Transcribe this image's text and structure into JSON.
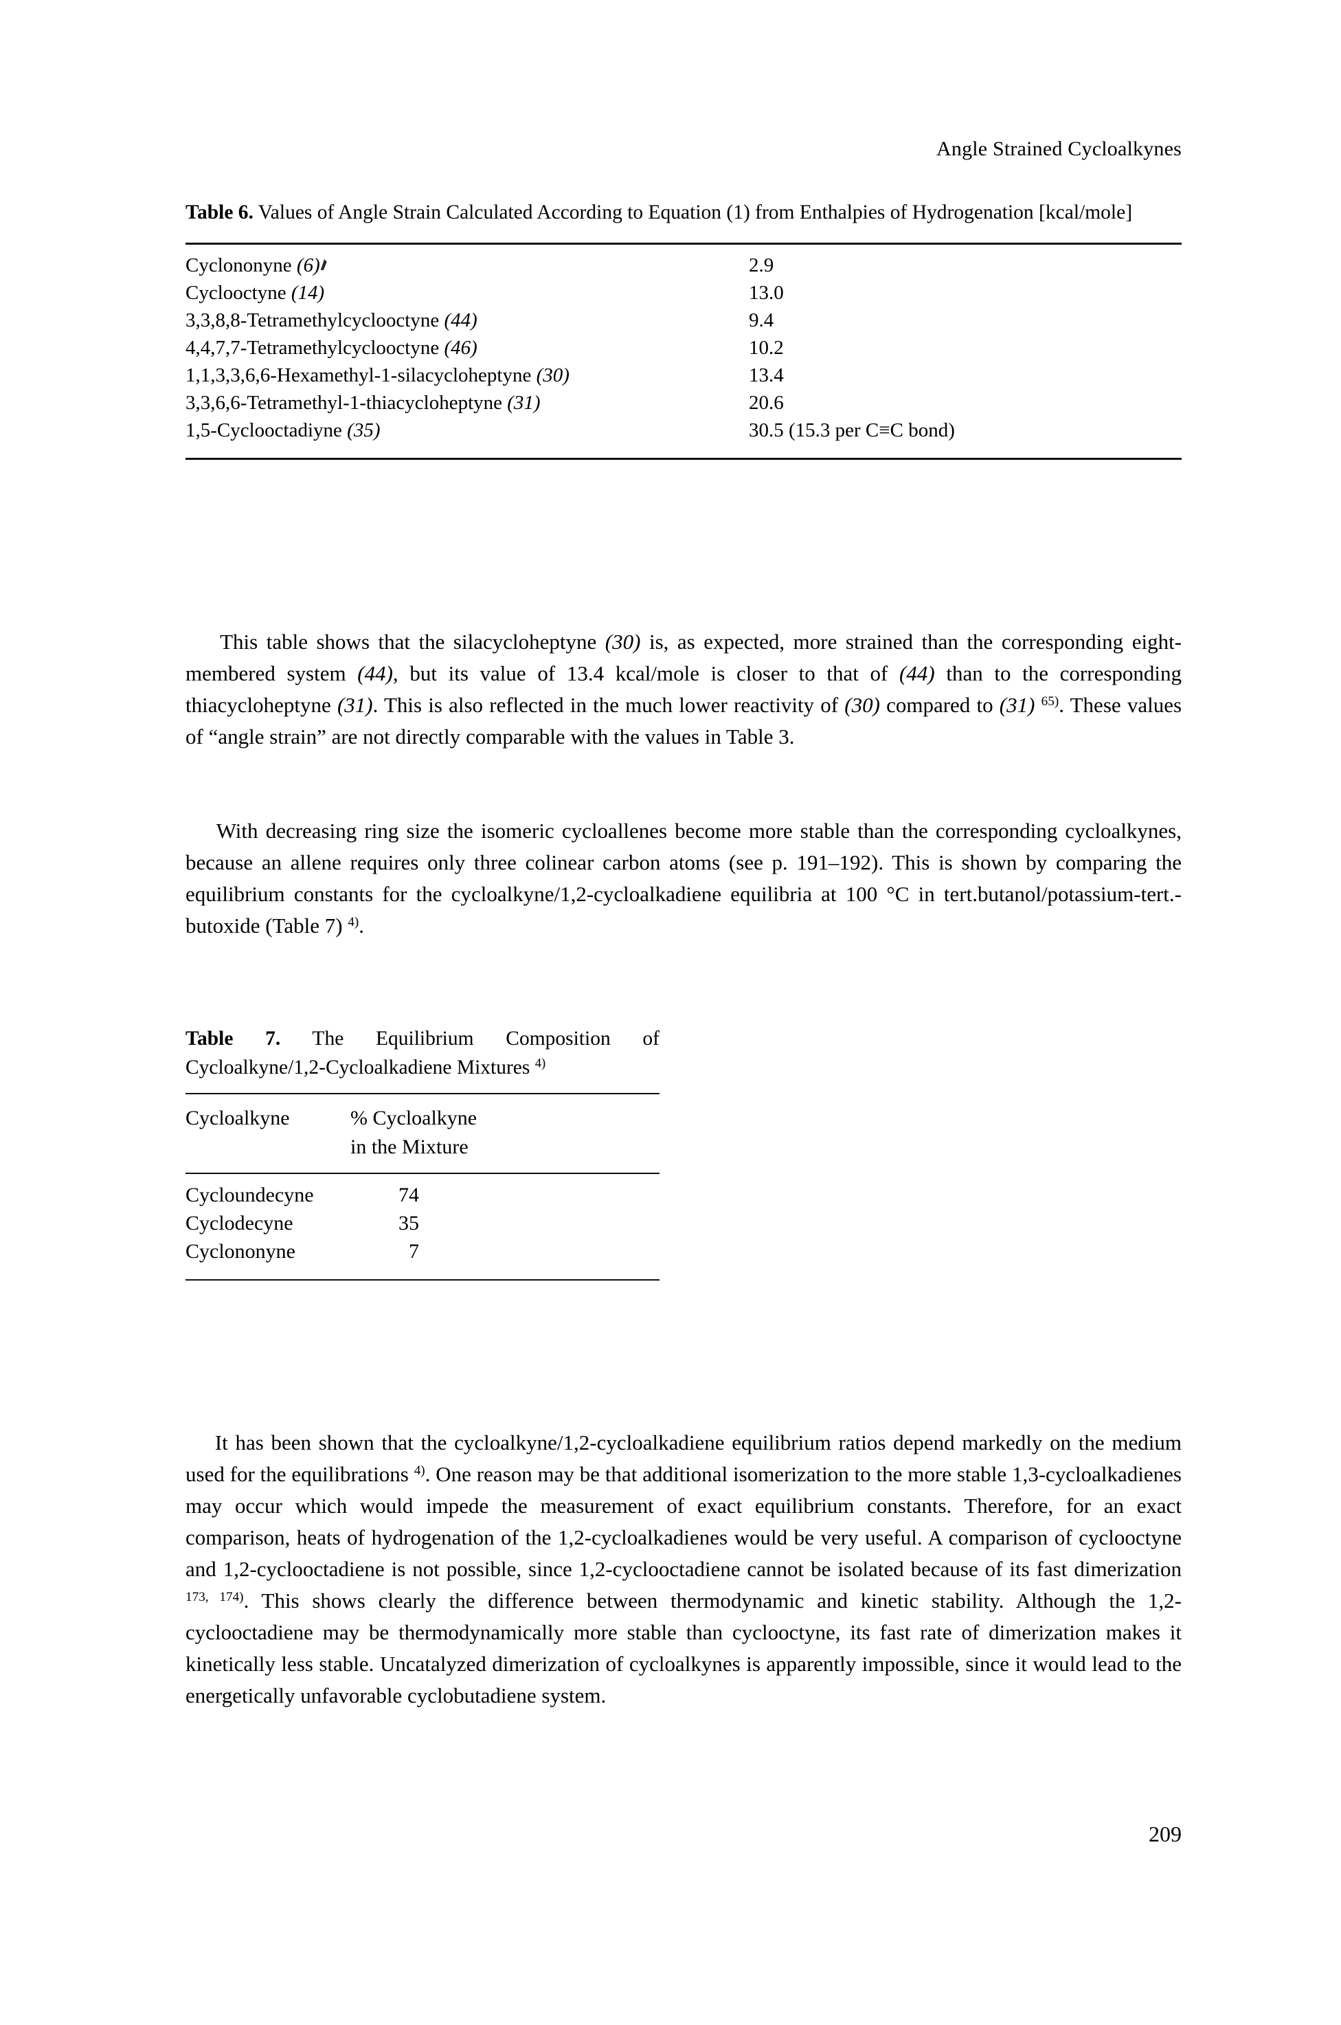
{
  "running_head": "Angle Strained Cycloalkynes",
  "folio": "209",
  "table6": {
    "caption_label": "Table 6.",
    "caption_text": " Values of Angle Strain Calculated According to Equation (1) from Enthalpies of Hydrogenation [kcal/mole]",
    "rows": [
      {
        "name": "Cyclononyne",
        "ref": "(6)",
        "value": "2.9"
      },
      {
        "name": "Cyclooctyne",
        "ref": "(14)",
        "value": "13.0"
      },
      {
        "name": "3,3,8,8-Tetramethylcyclooctyne",
        "ref": "(44)",
        "value": "9.4"
      },
      {
        "name": "4,4,7,7-Tetramethylcyclooctyne",
        "ref": "(46)",
        "value": "10.2"
      },
      {
        "name": "1,1,3,3,6,6-Hexamethyl-1-silacycloheptyne",
        "ref": "(30)",
        "value": "13.4"
      },
      {
        "name": "3,3,6,6-Tetramethyl-1-thiacycloheptyne",
        "ref": "(31)",
        "value": "20.6"
      },
      {
        "name": "1,5-Cyclooctadiyne",
        "ref": "(35)",
        "value": "30.5 (15.3 per C≡C bond)"
      }
    ]
  },
  "paragraph_1": {
    "segment_a": "This table shows that the silacycloheptyne ",
    "ref_30a": "(30)",
    "segment_b": " is, as expected, more strained than the corresponding eight-membered system ",
    "ref_44a": "(44)",
    "segment_c": ", but its value of 13.4 kcal/mole is closer to that of ",
    "ref_44b": "(44)",
    "segment_d": " than to the corresponding thiacycloheptyne ",
    "ref_31a": "(31)",
    "segment_e": ". This is also reflected in the much lower reactivity of ",
    "ref_30b": "(30)",
    "segment_f": " compared to ",
    "ref_31b": "(31)",
    "footnote_65": "65)",
    "segment_g": ". These values of “angle strain” are not directly comparable with the values in Table 3."
  },
  "paragraph_2": {
    "segment_a": "With decreasing ring size the isomeric cycloallenes become more stable than the corresponding cycloalkynes, because an allene requires only three colinear carbon atoms (see p. 191–192). This is shown by comparing the equilibrium constants for the cycloalkyne/1,2-cycloalkadiene equilibria at 100 °C in tert.butanol/potassium-tert.-butoxide (Table 7) ",
    "footnote_4": "4)",
    "segment_b": "."
  },
  "table7": {
    "caption_label": "Table 7.",
    "caption_text": " The Equilibrium Composition of Cycloalkyne/1,2-Cycloalkadiene Mixtures ",
    "caption_footnote": "4)",
    "columns": [
      {
        "line1": "Cycloalkyne",
        "line2": ""
      },
      {
        "line1": "% Cycloalkyne",
        "line2": "in the Mixture"
      }
    ],
    "rows": [
      {
        "name": "Cycloundecyne",
        "value": "74"
      },
      {
        "name": "Cyclodecyne",
        "value": "35"
      },
      {
        "name": "Cyclononyne",
        "value": "7"
      }
    ]
  },
  "paragraph_3": {
    "segment_a": "It has been shown that the cycloalkyne/1,2-cycloalkadiene equilibrium ratios depend markedly on the medium used for the equilibrations ",
    "footnote_4": "4)",
    "segment_b": ". One reason may be that additional isomerization to the more stable 1,3-cycloalkadienes may occur which would impede the measurement of exact equilibrium constants. Therefore, for an exact comparison, heats of hydrogenation of the 1,2-cycloalkadienes would be very useful. A comparison of cyclooctyne and 1,2-cyclooctadiene is not possible, since 1,2-cyclooctadiene cannot be isolated because of its fast dimerization ",
    "footnote_173_174": "173, 174)",
    "segment_c": ". This shows clearly the difference between thermodynamic and kinetic stability. Although the 1,2-cyclooctadiene may be thermodynamically more stable than cyclooctyne, its fast rate of dimerization makes it kinetically less stable. Uncatalyzed dimerization of cycloalkynes is apparently impossible, since it would lead to the energetically unfavorable cyclobutadiene system."
  }
}
